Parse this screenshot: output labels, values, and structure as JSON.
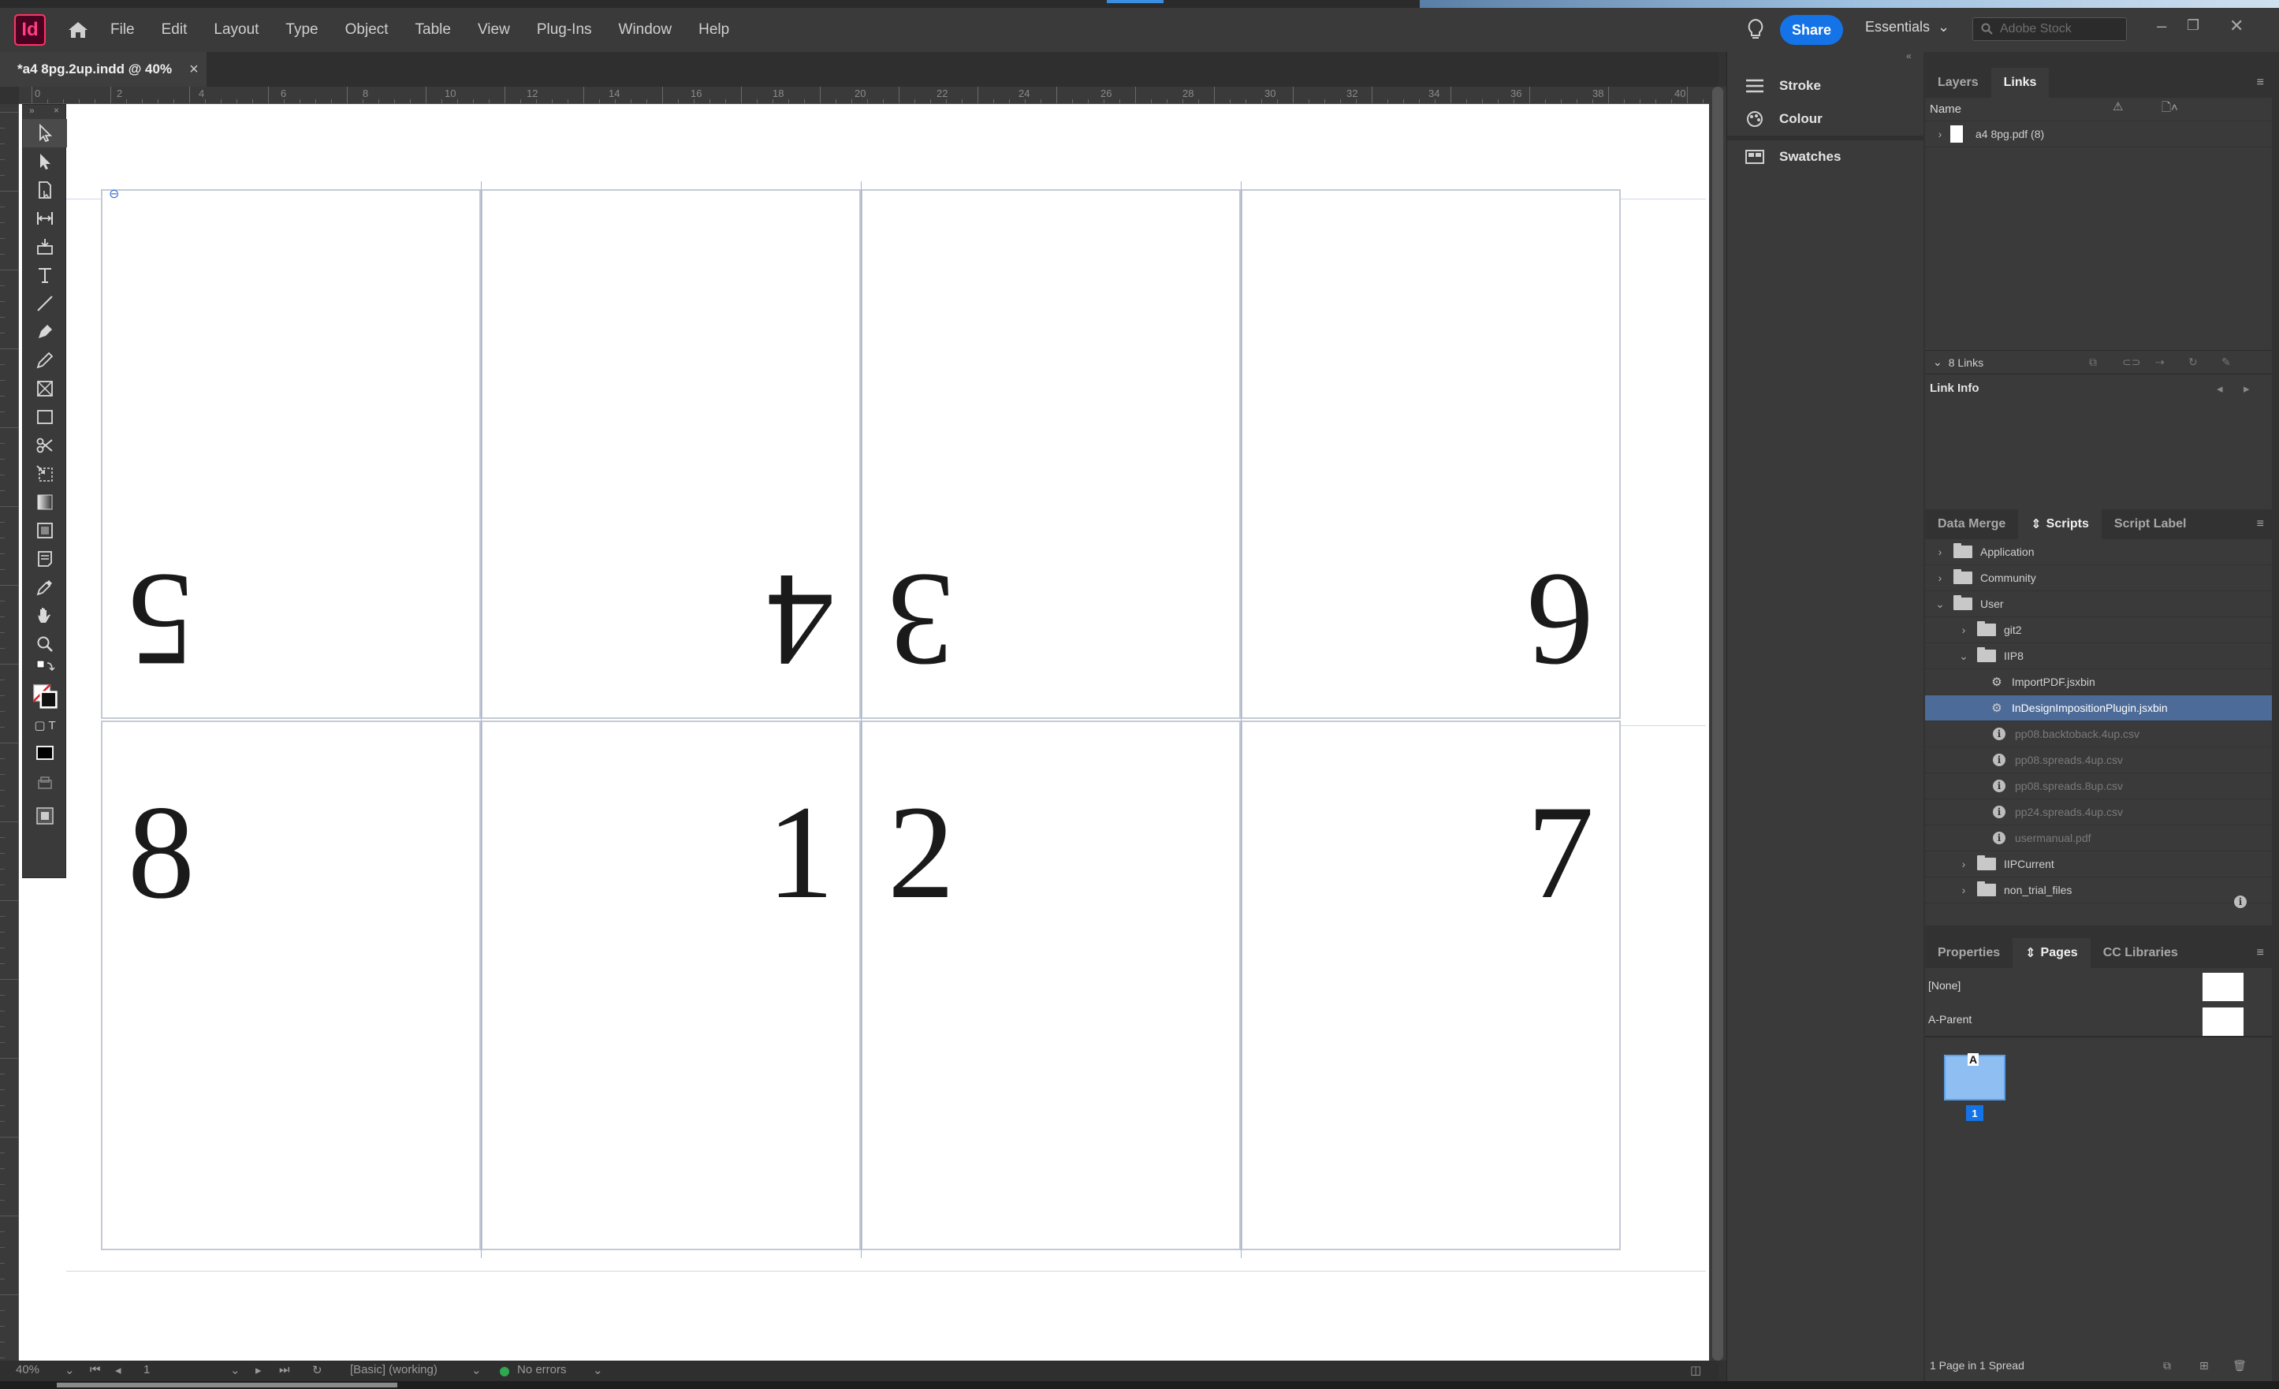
{
  "app": {
    "logo": "Id",
    "menu": [
      "File",
      "Edit",
      "Layout",
      "Type",
      "Object",
      "Table",
      "View",
      "Plug-Ins",
      "Window",
      "Help"
    ],
    "share_label": "Share",
    "workspace": "Essentials",
    "stock_placeholder": "Adobe Stock"
  },
  "document": {
    "tab_title": "*a4 8pg.2up.indd @ 40%",
    "ruler_numbers": [
      "0",
      "2",
      "4",
      "6",
      "8",
      "10",
      "12",
      "14",
      "16",
      "18",
      "20",
      "22",
      "24",
      "26",
      "28",
      "30",
      "32",
      "34",
      "36",
      "38",
      "40"
    ],
    "cells": [
      {
        "number": "5",
        "flipped": true
      },
      {
        "number": "4",
        "flipped": true
      },
      {
        "number": "3",
        "flipped": true
      },
      {
        "number": "6",
        "flipped": true
      },
      {
        "number": "8",
        "flipped": false
      },
      {
        "number": "1",
        "flipped": false
      },
      {
        "number": "2",
        "flipped": false
      },
      {
        "number": "7",
        "flipped": false
      }
    ]
  },
  "statusbar": {
    "zoom": "40%",
    "page": "1",
    "style": "[Basic] (working)",
    "preflight": "No errors",
    "preflight_color": "#2fa84f"
  },
  "mid_panels": {
    "items": [
      "Stroke",
      "Colour",
      "Swatches"
    ]
  },
  "links_panel": {
    "tabs": [
      "Layers",
      "Links"
    ],
    "active_tab": "Links",
    "column_name": "Name",
    "items": [
      {
        "name": "a4 8pg.pdf (8)"
      }
    ],
    "count": "8 Links",
    "link_info": "Link Info"
  },
  "scripts_panel": {
    "tabs": [
      "Data Merge",
      "Scripts",
      "Script Label"
    ],
    "active_tab": "Scripts",
    "tree": [
      {
        "label": "Application",
        "depth": 0,
        "kind": "folder",
        "chevron": "›"
      },
      {
        "label": "Community",
        "depth": 0,
        "kind": "folder",
        "chevron": "›"
      },
      {
        "label": "User",
        "depth": 0,
        "kind": "folder",
        "chevron": "⌄"
      },
      {
        "label": "git2",
        "depth": 1,
        "kind": "folder",
        "chevron": "›"
      },
      {
        "label": "IIP8",
        "depth": 1,
        "kind": "folder",
        "chevron": "⌄"
      },
      {
        "label": "ImportPDF.jsxbin",
        "depth": 2,
        "kind": "script"
      },
      {
        "label": "InDesignImpositionPlugin.jsxbin",
        "depth": 2,
        "kind": "script",
        "selected": true
      },
      {
        "label": "pp08.backtoback.4up.csv",
        "depth": 2,
        "kind": "info",
        "dim": true
      },
      {
        "label": "pp08.spreads.4up.csv",
        "depth": 2,
        "kind": "info",
        "dim": true
      },
      {
        "label": "pp08.spreads.8up.csv",
        "depth": 2,
        "kind": "info",
        "dim": true
      },
      {
        "label": "pp24.spreads.4up.csv",
        "depth": 2,
        "kind": "info",
        "dim": true
      },
      {
        "label": "usermanual.pdf",
        "depth": 2,
        "kind": "info",
        "dim": true
      },
      {
        "label": "IIPCurrent",
        "depth": 1,
        "kind": "folder",
        "chevron": "›"
      },
      {
        "label": "non_trial_files",
        "depth": 1,
        "kind": "folder",
        "chevron": "›"
      }
    ]
  },
  "pages_panel": {
    "tabs": [
      "Properties",
      "Pages",
      "CC Libraries"
    ],
    "active_tab": "Pages",
    "parents": [
      "[None]",
      "A-Parent"
    ],
    "thumb_letter": "A",
    "page_number": "1",
    "summary": "1 Page in 1 Spread"
  }
}
